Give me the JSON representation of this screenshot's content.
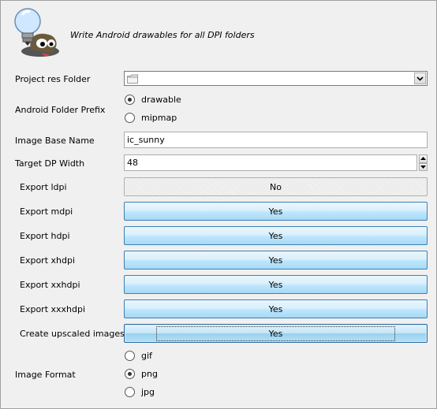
{
  "header": {
    "title": "Write Android drawables for all DPI folders",
    "logo_icon": "gimp-mascot-lightbulb-icon"
  },
  "project_res_folder": {
    "label": "Project res Folder",
    "value": "",
    "folder_icon": "folder-icon",
    "dropdown_icon": "chevron-down-icon"
  },
  "folder_prefix": {
    "label": "Android Folder Prefix",
    "options": [
      {
        "label": "drawable",
        "selected": true
      },
      {
        "label": "mipmap",
        "selected": false
      }
    ]
  },
  "image_base_name": {
    "label": "Image Base Name",
    "value": "ic_sunny"
  },
  "target_dp_width": {
    "label": "Target DP Width",
    "value": "48"
  },
  "exports": [
    {
      "label": "Export ldpi",
      "value": "No",
      "on": false
    },
    {
      "label": "Export mdpi",
      "value": "Yes",
      "on": true
    },
    {
      "label": "Export hdpi",
      "value": "Yes",
      "on": true
    },
    {
      "label": "Export xhdpi",
      "value": "Yes",
      "on": true
    },
    {
      "label": "Export xxhdpi",
      "value": "Yes",
      "on": true
    },
    {
      "label": "Export xxxhdpi",
      "value": "Yes",
      "on": true
    },
    {
      "label": "Create upscaled images",
      "value": "Yes",
      "on": true,
      "focused": true
    }
  ],
  "image_format": {
    "label": "Image Format",
    "options": [
      {
        "label": "gif",
        "selected": false
      },
      {
        "label": "png",
        "selected": true
      },
      {
        "label": "jpg",
        "selected": false
      }
    ]
  },
  "colors": {
    "background": "#f0f0f0",
    "toggle_on": "#bee6fd",
    "toggle_border": "#3c7fb1"
  }
}
